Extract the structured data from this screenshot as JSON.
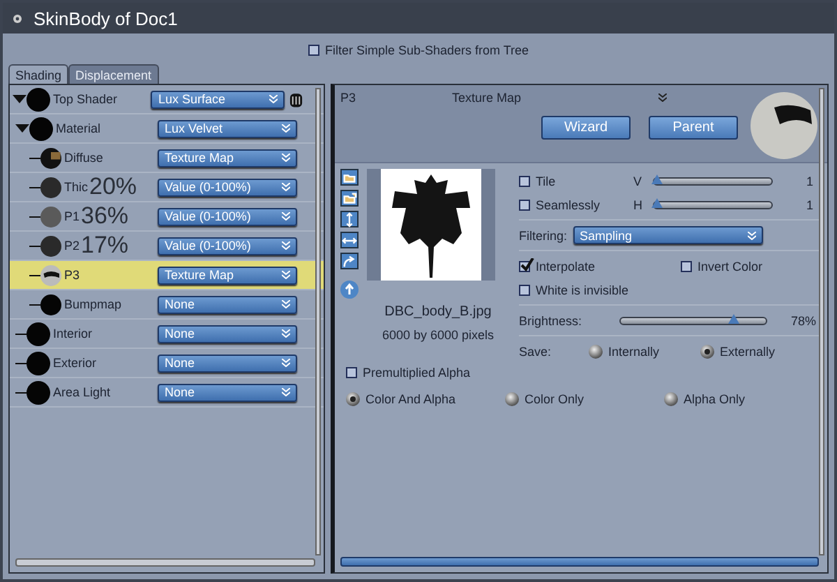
{
  "window": {
    "title": "SkinBody of Doc1"
  },
  "filter": {
    "label": "Filter Simple Sub-Shaders from Tree",
    "checked": false
  },
  "tabs": [
    {
      "label": "Shading",
      "selected": true
    },
    {
      "label": "Displacement",
      "selected": false
    }
  ],
  "tree": [
    {
      "label": "Top Shader",
      "kind": "black",
      "value": "Lux Surface",
      "selected": false,
      "expanded": true,
      "trash": true,
      "children": [
        {
          "label": "Material",
          "kind": "black",
          "value": "Lux Velvet",
          "selected": false,
          "expanded": true,
          "children": [
            {
              "label": "Diffuse",
              "kind": "texture",
              "value": "Texture Map",
              "selected": false
            },
            {
              "label": "Thic",
              "overlay": "20%",
              "kind": "dark",
              "value": "Value (0-100%)",
              "selected": false
            },
            {
              "label": "P1",
              "overlay": "36%",
              "kind": "gray",
              "value": "Value (0-100%)",
              "selected": false
            },
            {
              "label": "P2",
              "overlay": "17%",
              "kind": "dark",
              "value": "Value (0-100%)",
              "selected": false
            },
            {
              "label": "P3",
              "kind": "stripe",
              "value": "Texture Map",
              "selected": true
            },
            {
              "label": "Bumpmap",
              "kind": "black",
              "value": "None",
              "selected": false
            }
          ]
        },
        {
          "label": "Interior",
          "kind": "black",
          "value": "None",
          "selected": false
        },
        {
          "label": "Exterior",
          "kind": "black",
          "value": "None",
          "selected": false
        },
        {
          "label": "Area Light",
          "kind": "black",
          "value": "None",
          "selected": false
        }
      ]
    }
  ],
  "detail": {
    "name": "P3",
    "type": "Texture Map",
    "buttons": [
      "Wizard",
      "Parent"
    ],
    "image": {
      "filename": "DBC_body_B.jpg",
      "size": "6000 by 6000 pixels"
    },
    "tiling": [
      {
        "label": "Tile",
        "checked": false,
        "axis": "V",
        "level": 0.02,
        "reading": "1"
      },
      {
        "label": "Seamlessly",
        "checked": false,
        "axis": "H",
        "level": 0.02,
        "reading": "1"
      }
    ],
    "filtering": {
      "label": "Filtering:",
      "value": "Sampling"
    },
    "options": [
      {
        "label": "Interpolate",
        "checked": true
      },
      {
        "label": "Invert Color",
        "checked": false
      },
      {
        "label": "White is invisible",
        "checked": false
      }
    ],
    "brightness": {
      "label": "Brightness:",
      "level": 0.78,
      "reading": "78%"
    },
    "save": {
      "label": "Save:",
      "options": [
        {
          "label": "Internally",
          "selected": false
        },
        {
          "label": "Externally",
          "selected": true
        }
      ]
    },
    "premultiplied": {
      "label": "Premultiplied Alpha",
      "checked": false
    },
    "channels": [
      {
        "label": "Color And Alpha",
        "selected": true
      },
      {
        "label": "Color Only",
        "selected": false
      },
      {
        "label": "Alpha Only",
        "selected": false
      }
    ]
  }
}
